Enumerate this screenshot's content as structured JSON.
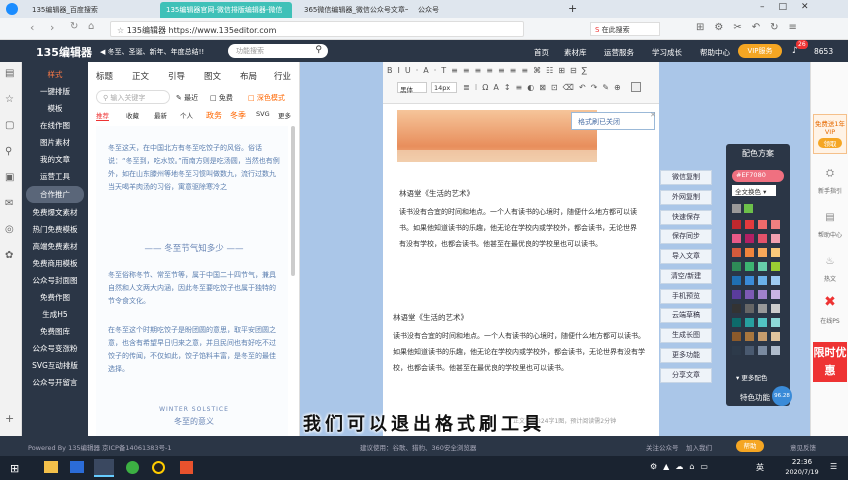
{
  "tabs": [
    {
      "label": "135编辑器_百度搜索"
    },
    {
      "label": "135编辑器官网-微信排版编辑器-微信"
    },
    {
      "label": "365微信编辑器_微信公众号文章一键"
    },
    {
      "label": "公众号"
    }
  ],
  "address": {
    "site_label": "135编辑器",
    "url": "https://www.135editor.com",
    "search_placeholder": "在此搜索"
  },
  "header": {
    "logo": "135编辑器",
    "holiday": "◀ 冬至、圣诞、新年、年度总结!!",
    "search_placeholder": "功能搜索",
    "links": [
      "首页",
      "素材库",
      "运营服务",
      "学习成长",
      "帮助中心"
    ],
    "vip": "VIP服务",
    "badge": "26",
    "user_id": "8653"
  },
  "nav": [
    "样式",
    "一键排版",
    "模板",
    "在线作图",
    "图片素材",
    "我的文章",
    "运营工具",
    "合作推广",
    "免费爆文素材",
    "热门免费模板",
    "高端免费素材",
    "免费商用模板",
    "公众号封面图",
    "免费作图",
    "生成H5",
    "免费图库",
    "公众号变涨粉",
    "SVG互动排版",
    "公众号开留言"
  ],
  "material": {
    "tabs": [
      "标题",
      "正文",
      "引导",
      "图文",
      "布局",
      "行业"
    ],
    "search_placeholder": "输入关键字",
    "recent": "最近",
    "free": "免费",
    "dark": "深色模式",
    "filters": [
      "推荐",
      "收藏",
      "最新",
      "个人",
      "政务",
      "冬季",
      "SVG",
      "更多"
    ],
    "text1": "冬至这天，在中国北方有冬至吃饺子的风俗。俗话说：“冬至到，吃水饺。”而南方则是吃汤圆，当然也有例外，如在山东滕州等地冬至习惯叫做数九，流行过数九当天喝羊肉汤的习俗，寓意驱除寒冷之",
    "heading": "冬至节气知多少",
    "text2": "冬至俗称冬节、常至节等，属于中国二十四节气，兼具自然和人文两大内涵，因此冬至要吃饺子也属于独特的节令食文化。",
    "text3": "在冬至这个时期吃饺子是盼团圆的意思，取平安团圆之意，也含有希望早日归来之意，并且民间也有好吃不过饺子的传闻，不仅如此，饺子馅料丰富，是冬至的最佳选择。",
    "en": "WINTER SOLSTICE",
    "sub": "冬至的意义"
  },
  "editor": {
    "font": "黑体",
    "size": "14px",
    "tooltip": "格式刷已关闭",
    "title1": "林语堂《生活的艺术》",
    "p1": "读书没有合宜的时间和地点。一个人有读书的心境时，随便什么地方都可以读书。如果他知道读书的乐趣，他无论在学校内或学校外，都会读书，无论世界有没有学校，也都会读书。他甚至在最优良的学校里也可以读书。",
    "title2": "林语堂《生活的艺术》",
    "p2": "读书没有合宜的时间和地点。一个人有读书的心境时，随便什么地方都可以读书。如果他知道读书的乐趣，他无论在学校内或学校外，都会读书，无论世界有没有学校，也都会读书。他甚至在最优良的学校里也可以读书。",
    "count": "正文字数324字1图，预计阅读需2分钟"
  },
  "functions": [
    "微信复制",
    "外网复制",
    "快速保存",
    "保存同步",
    "导入文章",
    "清空/新建",
    "手机预览",
    "云端草稿",
    "生成长图",
    "更多功能",
    "分享文章"
  ],
  "palette": {
    "title": "配色方案",
    "hex": "#EF7080",
    "mode": "全文换色",
    "more": "更多配色",
    "special": "特色功能",
    "accent": "#ef7080",
    "colors": [
      "#c0282d",
      "#e33a3d",
      "#f06b6b",
      "#f08080",
      "#e95a88",
      "#b22064",
      "#e3526a",
      "#f1a0b0",
      "#d45b3c",
      "#f0843c",
      "#f7a85a",
      "#f9c97b",
      "#2e8b57",
      "#3cb371",
      "#66cdaa",
      "#9acd32",
      "#1f6fb2",
      "#3a8bd8",
      "#6bb1ea",
      "#9ecbf1",
      "#5a3c9c",
      "#7d5ab4",
      "#a182cc",
      "#c9b3e3",
      "#333333",
      "#666666",
      "#999999",
      "#cccccc",
      "#0d6b6b",
      "#27a0a0",
      "#52c2c2",
      "#8fd9d9",
      "#8b5a2b",
      "#a8763e",
      "#c69c6d",
      "#e0c49e",
      "#2d3a4a",
      "#4a5a70",
      "#7a8aa0",
      "#b0bccc"
    ]
  },
  "rail": {
    "promo": "免费送1年VIP",
    "promo_btn": "领取",
    "new_guide": "新手指引",
    "help": "帮助中心",
    "hot": "热文",
    "ps": "在线PS",
    "limited": "限时优惠"
  },
  "subtitle": "我们可以退出格式刷工具",
  "status": {
    "powered": "Powered By 135编辑器 京ICP备14061383号-1",
    "browser": "建议使用：谷歌、猎豹、360安全浏览器",
    "follow": "关注公众号",
    "join": "加入我们",
    "help": "帮助",
    "feedback": "意见反馈",
    "page": "96.28"
  },
  "taskbar": {
    "time": "22:36",
    "date": "2020/7/19",
    "ime": "英"
  }
}
